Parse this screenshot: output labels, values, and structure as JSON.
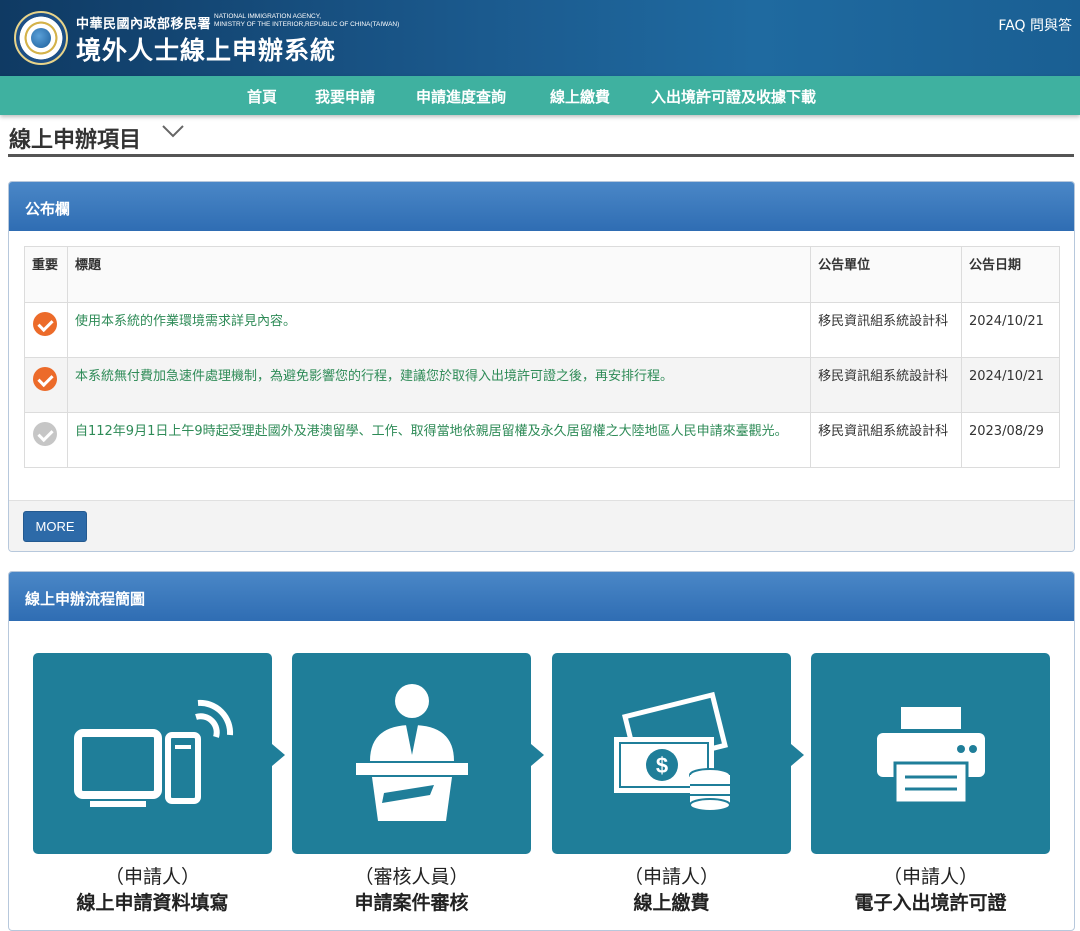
{
  "header": {
    "agency_cn": "中華民國內政部移民署",
    "agency_en_line1": "NATIONAL IMMIGRATION AGENCY,",
    "agency_en_line2": "MINISTRY OF THE INTERIOR,REPUBLIC OF CHINA(TAIWAN)",
    "system_title": "境外人士線上申辦系統",
    "faq_label": "FAQ 問與答"
  },
  "nav": {
    "items": [
      "首頁",
      "我要申請",
      "申請進度查詢",
      "線上繳費",
      "入出境許可證及收據下載"
    ]
  },
  "section_title": "線上申辦項目",
  "bulletin": {
    "title": "公布欄",
    "columns": {
      "important": "重要",
      "title": "標題",
      "unit": "公告單位",
      "date": "公告日期"
    },
    "rows": [
      {
        "important": true,
        "title": "使用本系統的作業環境需求詳見內容。",
        "unit": "移民資訊組系統設計科",
        "date": "2024/10/21"
      },
      {
        "important": true,
        "title": "本系統無付費加急速件處理機制，為避免影響您的行程，建議您於取得入出境許可證之後，再安排行程。",
        "unit": "移民資訊組系統設計科",
        "date": "2024/10/21"
      },
      {
        "important": false,
        "title": "自112年9月1日上午9時起受理赴國外及港澳留學、工作、取得當地依親居留權及永久居留權之大陸地區人民申請來臺觀光。",
        "unit": "移民資訊組系統設計科",
        "date": "2023/08/29"
      }
    ],
    "more_label": "MORE"
  },
  "flow": {
    "title": "線上申辦流程簡圖",
    "steps": [
      {
        "role": "（申請人）",
        "label": "線上申請資料填寫",
        "icon": "computer-icon"
      },
      {
        "role": "（審核人員）",
        "label": "申請案件審核",
        "icon": "reviewer-icon"
      },
      {
        "role": "（申請人）",
        "label": "線上繳費",
        "icon": "money-icon"
      },
      {
        "role": "（申請人）",
        "label": "電子入出境許可證",
        "icon": "printer-icon"
      }
    ]
  },
  "colors": {
    "header_bg": "#1b5a8e",
    "nav_bg": "#3fb1a0",
    "panel_head": "#2f6db3",
    "link_green": "#2e8b57",
    "badge_orange": "#ec6b2a",
    "flow_teal": "#1f7e99"
  }
}
